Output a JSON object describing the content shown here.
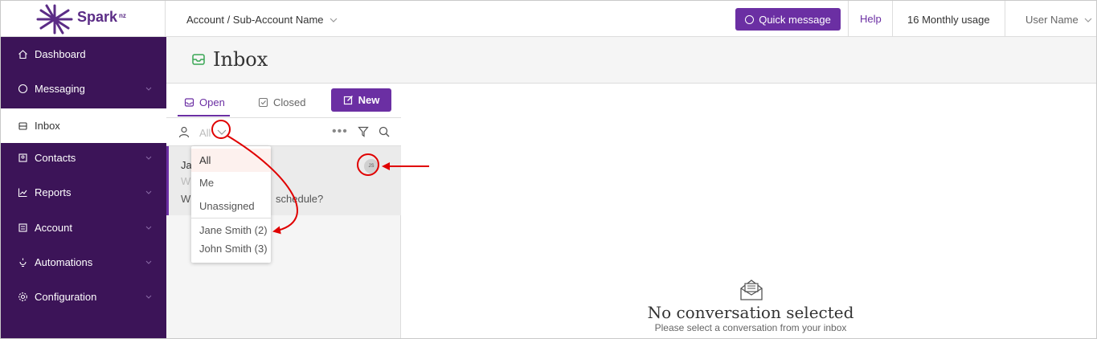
{
  "brand": {
    "name": "Spark",
    "superscript": "nz",
    "primary_color": "#6b2fa3",
    "sidebar_color": "#3c1458"
  },
  "header": {
    "breadcrumb": "Account / Sub-Account Name",
    "quick_message": "Quick message",
    "help": "Help",
    "usage": "16 Monthly usage",
    "user": "User Name"
  },
  "sidebar": {
    "items": [
      {
        "label": "Dashboard",
        "icon": "home-icon"
      },
      {
        "label": "Messaging",
        "icon": "chat-icon",
        "expandable": true
      },
      {
        "label": "Inbox",
        "icon": "inbox-icon",
        "active": true
      },
      {
        "label": "Contacts",
        "icon": "contacts-icon",
        "expandable": true
      },
      {
        "label": "Reports",
        "icon": "chart-icon",
        "expandable": true
      },
      {
        "label": "Account",
        "icon": "account-icon",
        "expandable": true
      },
      {
        "label": "Automations",
        "icon": "bolt-icon",
        "expandable": true
      },
      {
        "label": "Configuration",
        "icon": "gear-icon",
        "expandable": true
      }
    ]
  },
  "page": {
    "title": "Inbox"
  },
  "list": {
    "tabs": [
      {
        "label": "Open",
        "active": true
      },
      {
        "label": "Closed"
      }
    ],
    "new_button": "New",
    "filter": {
      "value": "All"
    },
    "conversation": {
      "name": "Ja",
      "sub": "W",
      "message": "W",
      "message_tail": "schedule?",
      "avatar": "JS"
    }
  },
  "dropdown": {
    "options": [
      "All",
      "Me",
      "Unassigned"
    ],
    "agents": [
      "Jane Smith (2)",
      "John Smith (3)"
    ],
    "selected": "All"
  },
  "empty_state": {
    "title": "No conversation selected",
    "subtitle": "Please select a conversation from your inbox"
  }
}
